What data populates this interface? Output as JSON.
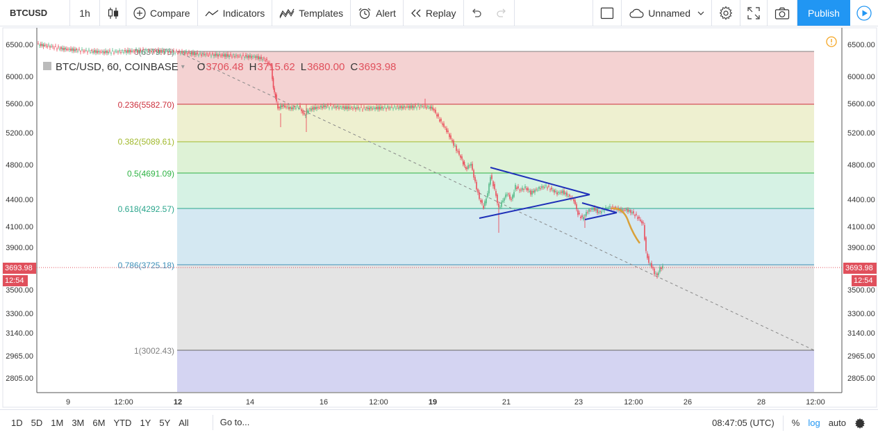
{
  "toolbar": {
    "symbol": "BTCUSD",
    "interval": "1h",
    "compare": "Compare",
    "indicators": "Indicators",
    "templates": "Templates",
    "alert": "Alert",
    "replay": "Replay",
    "layout_name": "Unnamed",
    "publish": "Publish"
  },
  "legend": {
    "symbol": "BTC/USD, 60, COINBASE",
    "o_label": "O",
    "o_value": "3706.48",
    "h_label": "H",
    "h_value": "3715.62",
    "l_label": "L",
    "l_value": "3680.00",
    "c_label": "C",
    "c_value": "3693.98"
  },
  "price_axis": {
    "ticks": [
      "6500.00",
      "6000.00",
      "5600.00",
      "5200.00",
      "4800.00",
      "4400.00",
      "4100.00",
      "3900.00",
      "3500.00",
      "3300.00",
      "3140.00",
      "2965.00",
      "2805.00"
    ],
    "last_price": "3693.98",
    "countdown": "12:54"
  },
  "time_axis": {
    "ticks": [
      "9",
      "12:00",
      "12",
      "14",
      "16",
      "12:00",
      "19",
      "21",
      "23",
      "12:00",
      "26",
      "28",
      "12:00"
    ]
  },
  "fib_levels": [
    {
      "label": "0(6379.75)",
      "color": "#808080"
    },
    {
      "label": "0.236(5582.70)",
      "color": "#cc2f3c"
    },
    {
      "label": "0.382(5089.61)",
      "color": "#a0b82a"
    },
    {
      "label": "0.5(4691.09)",
      "color": "#2fb344"
    },
    {
      "label": "0.618(4292.57)",
      "color": "#2aa58c"
    },
    {
      "label": "0.786(3725.18)",
      "color": "#3c8fb8"
    },
    {
      "label": "1(3002.43)",
      "color": "#808080"
    }
  ],
  "colors": {
    "up": "#53b987",
    "down": "#eb4d5c",
    "accent": "#2196f3",
    "triangle": "#1e2fb8",
    "projection": "#d9a13a"
  },
  "bottom": {
    "ranges": [
      "1D",
      "5D",
      "1M",
      "3M",
      "6M",
      "YTD",
      "1Y",
      "5Y",
      "All"
    ],
    "goto": "Go to...",
    "time": "08:47:05 (UTC)",
    "percent": "%",
    "log": "log",
    "auto": "auto"
  },
  "icons": [
    "candles-icon",
    "plus-circle-icon",
    "indicators-icon",
    "templates-icon",
    "alarm-clock-icon",
    "replay-icon",
    "undo-icon",
    "redo-icon",
    "square-icon",
    "cloud-icon",
    "chevron-down-icon",
    "gear-icon",
    "fullscreen-icon",
    "camera-icon",
    "play-icon",
    "warning-icon"
  ]
}
